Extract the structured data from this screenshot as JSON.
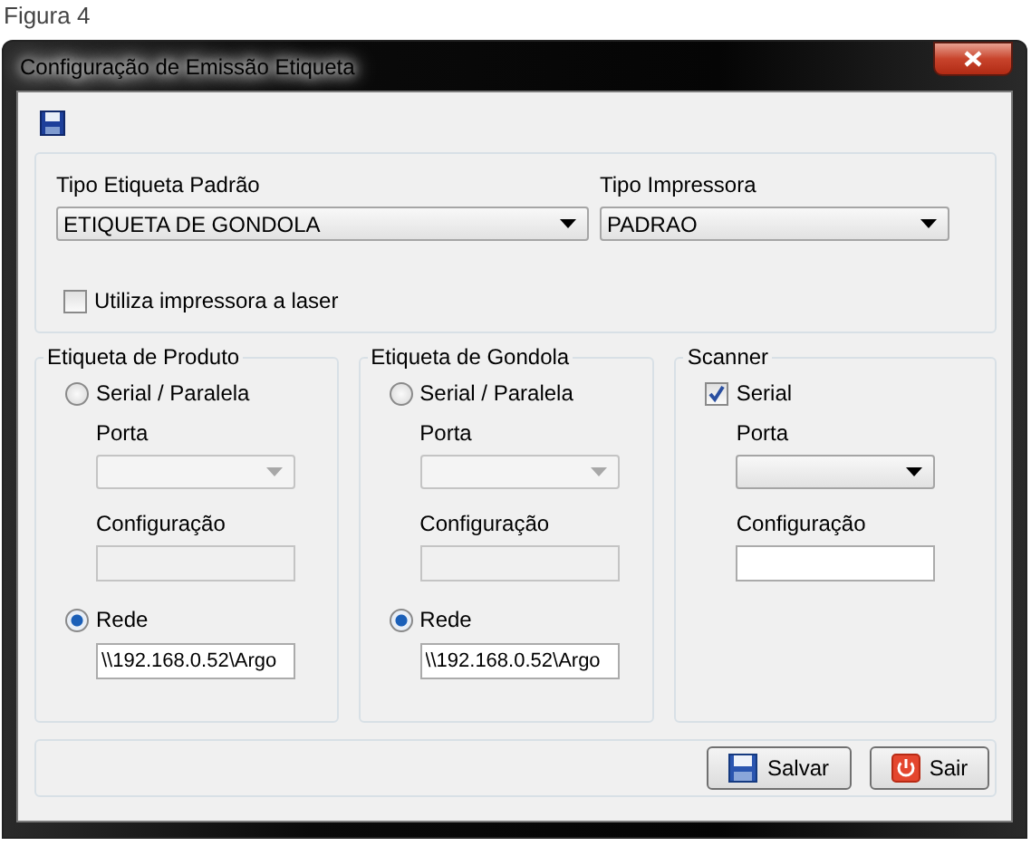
{
  "caption": "Figura 4",
  "window": {
    "title": "Configuração de Emissão Etiqueta"
  },
  "defaults": {
    "label_type": {
      "label": "Tipo Etiqueta Padrão",
      "value": "ETIQUETA DE GONDOLA"
    },
    "printer_type": {
      "label": "Tipo Impressora",
      "value": "PADRAO"
    },
    "laser": {
      "label": "Utiliza impressora a laser",
      "checked": false
    }
  },
  "groups": [
    {
      "kind": "printer",
      "title": "Etiqueta de Produto",
      "serial": {
        "label": "Serial / Paralela",
        "selected": false
      },
      "port": {
        "label": "Porta",
        "disabled": true
      },
      "config": {
        "label": "Configuração",
        "disabled": true
      },
      "network": {
        "label": "Rede",
        "selected": true,
        "value": "\\\\192.168.0.52\\Argo"
      }
    },
    {
      "kind": "printer",
      "title": "Etiqueta de Gondola",
      "serial": {
        "label": "Serial / Paralela",
        "selected": false
      },
      "port": {
        "label": "Porta",
        "disabled": true
      },
      "config": {
        "label": "Configuração",
        "disabled": true
      },
      "network": {
        "label": "Rede",
        "selected": true,
        "value": "\\\\192.168.0.52\\Argo"
      }
    },
    {
      "kind": "scanner",
      "title": "Scanner",
      "serial": {
        "label": "Serial",
        "checked": true
      },
      "port": {
        "label": "Porta",
        "disabled": false
      },
      "config": {
        "label": "Configuração",
        "disabled": false
      }
    }
  ],
  "buttons": [
    {
      "kind": "save",
      "label": "Salvar"
    },
    {
      "kind": "exit",
      "label": "Sair"
    }
  ]
}
